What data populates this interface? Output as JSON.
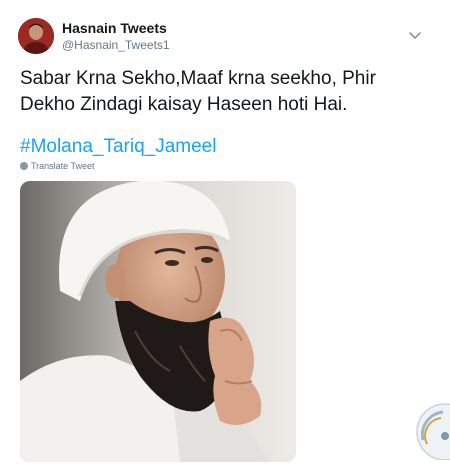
{
  "user": {
    "name": "Hasnain Tweets",
    "handle": "@Hasnain_Tweets1"
  },
  "tweet": {
    "line1": "Sabar Krna Sekho,Maaf krna seekho, Phir",
    "line2": "Dekho Zindagi kaisay Haseen hoti Hai.",
    "hashtag": "#Molana_Tariq_Jameel",
    "translate": "Translate Tweet"
  },
  "icons": {
    "caret": "chevron-down-icon",
    "translate": "globe-icon"
  },
  "colors": {
    "link": "#1da1f2",
    "text": "#14171a",
    "muted": "#657786"
  }
}
